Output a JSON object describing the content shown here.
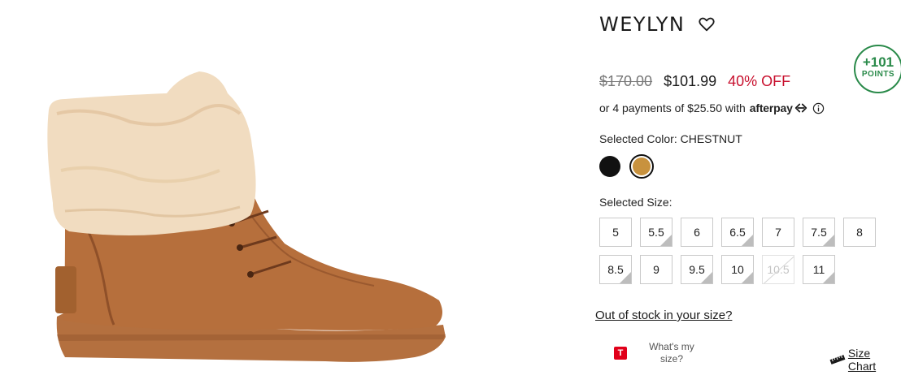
{
  "product": {
    "title": "WEYLYN",
    "image_alt": "boot"
  },
  "rewards": {
    "points_value": "+101",
    "points_label": "POINTS",
    "accent_color": "#2a8a4a"
  },
  "price": {
    "original": "$170.00",
    "sale": "$101.99",
    "discount": "40% OFF",
    "discount_color": "#c8102e"
  },
  "afterpay": {
    "text": "or 4 payments of $25.50 with",
    "brand": "afterpay"
  },
  "color": {
    "label": "Selected Color: CHESTNUT",
    "options": [
      {
        "name": "black",
        "hex": "#111111",
        "selected": false
      },
      {
        "name": "chestnut",
        "hex": "#c8923e",
        "selected": true
      }
    ]
  },
  "size": {
    "label": "Selected Size:",
    "options": [
      {
        "value": "5",
        "status": "available"
      },
      {
        "value": "5.5",
        "status": "low"
      },
      {
        "value": "6",
        "status": "available"
      },
      {
        "value": "6.5",
        "status": "low"
      },
      {
        "value": "7",
        "status": "available"
      },
      {
        "value": "7.5",
        "status": "low"
      },
      {
        "value": "8",
        "status": "available"
      },
      {
        "value": "8.5",
        "status": "low"
      },
      {
        "value": "9",
        "status": "available"
      },
      {
        "value": "9.5",
        "status": "low"
      },
      {
        "value": "10",
        "status": "low"
      },
      {
        "value": "10.5",
        "status": "out-of-stock"
      },
      {
        "value": "11",
        "status": "low"
      }
    ]
  },
  "links": {
    "out_of_stock": "Out of stock in your size?",
    "size_chart": "Size Chart"
  },
  "truefit": {
    "icon_letter": "T",
    "line1": "What's my",
    "line2": "size?"
  },
  "icons": {
    "wishlist": "heart-icon",
    "info": "info-icon",
    "afterpay": "afterpay-logo-icon",
    "truefit": "truefit-icon",
    "size_chart": "ruler-icon"
  }
}
